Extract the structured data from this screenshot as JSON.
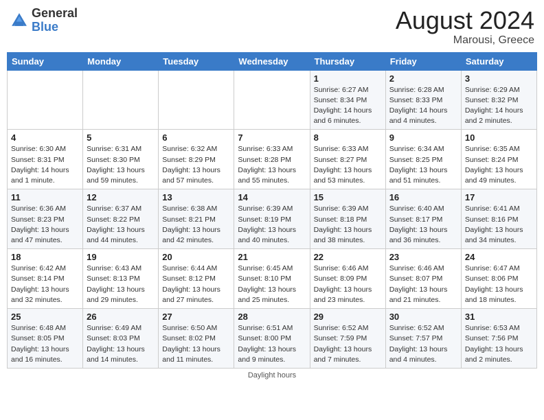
{
  "header": {
    "logo_general": "General",
    "logo_blue": "Blue",
    "month_year": "August 2024",
    "location": "Marousi, Greece"
  },
  "days_of_week": [
    "Sunday",
    "Monday",
    "Tuesday",
    "Wednesday",
    "Thursday",
    "Friday",
    "Saturday"
  ],
  "footer": {
    "note": "Daylight hours"
  },
  "weeks": [
    [
      {
        "day": "",
        "info": ""
      },
      {
        "day": "",
        "info": ""
      },
      {
        "day": "",
        "info": ""
      },
      {
        "day": "",
        "info": ""
      },
      {
        "day": "1",
        "info": "Sunrise: 6:27 AM\nSunset: 8:34 PM\nDaylight: 14 hours\nand 6 minutes."
      },
      {
        "day": "2",
        "info": "Sunrise: 6:28 AM\nSunset: 8:33 PM\nDaylight: 14 hours\nand 4 minutes."
      },
      {
        "day": "3",
        "info": "Sunrise: 6:29 AM\nSunset: 8:32 PM\nDaylight: 14 hours\nand 2 minutes."
      }
    ],
    [
      {
        "day": "4",
        "info": "Sunrise: 6:30 AM\nSunset: 8:31 PM\nDaylight: 14 hours\nand 1 minute."
      },
      {
        "day": "5",
        "info": "Sunrise: 6:31 AM\nSunset: 8:30 PM\nDaylight: 13 hours\nand 59 minutes."
      },
      {
        "day": "6",
        "info": "Sunrise: 6:32 AM\nSunset: 8:29 PM\nDaylight: 13 hours\nand 57 minutes."
      },
      {
        "day": "7",
        "info": "Sunrise: 6:33 AM\nSunset: 8:28 PM\nDaylight: 13 hours\nand 55 minutes."
      },
      {
        "day": "8",
        "info": "Sunrise: 6:33 AM\nSunset: 8:27 PM\nDaylight: 13 hours\nand 53 minutes."
      },
      {
        "day": "9",
        "info": "Sunrise: 6:34 AM\nSunset: 8:25 PM\nDaylight: 13 hours\nand 51 minutes."
      },
      {
        "day": "10",
        "info": "Sunrise: 6:35 AM\nSunset: 8:24 PM\nDaylight: 13 hours\nand 49 minutes."
      }
    ],
    [
      {
        "day": "11",
        "info": "Sunrise: 6:36 AM\nSunset: 8:23 PM\nDaylight: 13 hours\nand 47 minutes."
      },
      {
        "day": "12",
        "info": "Sunrise: 6:37 AM\nSunset: 8:22 PM\nDaylight: 13 hours\nand 44 minutes."
      },
      {
        "day": "13",
        "info": "Sunrise: 6:38 AM\nSunset: 8:21 PM\nDaylight: 13 hours\nand 42 minutes."
      },
      {
        "day": "14",
        "info": "Sunrise: 6:39 AM\nSunset: 8:19 PM\nDaylight: 13 hours\nand 40 minutes."
      },
      {
        "day": "15",
        "info": "Sunrise: 6:39 AM\nSunset: 8:18 PM\nDaylight: 13 hours\nand 38 minutes."
      },
      {
        "day": "16",
        "info": "Sunrise: 6:40 AM\nSunset: 8:17 PM\nDaylight: 13 hours\nand 36 minutes."
      },
      {
        "day": "17",
        "info": "Sunrise: 6:41 AM\nSunset: 8:16 PM\nDaylight: 13 hours\nand 34 minutes."
      }
    ],
    [
      {
        "day": "18",
        "info": "Sunrise: 6:42 AM\nSunset: 8:14 PM\nDaylight: 13 hours\nand 32 minutes."
      },
      {
        "day": "19",
        "info": "Sunrise: 6:43 AM\nSunset: 8:13 PM\nDaylight: 13 hours\nand 29 minutes."
      },
      {
        "day": "20",
        "info": "Sunrise: 6:44 AM\nSunset: 8:12 PM\nDaylight: 13 hours\nand 27 minutes."
      },
      {
        "day": "21",
        "info": "Sunrise: 6:45 AM\nSunset: 8:10 PM\nDaylight: 13 hours\nand 25 minutes."
      },
      {
        "day": "22",
        "info": "Sunrise: 6:46 AM\nSunset: 8:09 PM\nDaylight: 13 hours\nand 23 minutes."
      },
      {
        "day": "23",
        "info": "Sunrise: 6:46 AM\nSunset: 8:07 PM\nDaylight: 13 hours\nand 21 minutes."
      },
      {
        "day": "24",
        "info": "Sunrise: 6:47 AM\nSunset: 8:06 PM\nDaylight: 13 hours\nand 18 minutes."
      }
    ],
    [
      {
        "day": "25",
        "info": "Sunrise: 6:48 AM\nSunset: 8:05 PM\nDaylight: 13 hours\nand 16 minutes."
      },
      {
        "day": "26",
        "info": "Sunrise: 6:49 AM\nSunset: 8:03 PM\nDaylight: 13 hours\nand 14 minutes."
      },
      {
        "day": "27",
        "info": "Sunrise: 6:50 AM\nSunset: 8:02 PM\nDaylight: 13 hours\nand 11 minutes."
      },
      {
        "day": "28",
        "info": "Sunrise: 6:51 AM\nSunset: 8:00 PM\nDaylight: 13 hours\nand 9 minutes."
      },
      {
        "day": "29",
        "info": "Sunrise: 6:52 AM\nSunset: 7:59 PM\nDaylight: 13 hours\nand 7 minutes."
      },
      {
        "day": "30",
        "info": "Sunrise: 6:52 AM\nSunset: 7:57 PM\nDaylight: 13 hours\nand 4 minutes."
      },
      {
        "day": "31",
        "info": "Sunrise: 6:53 AM\nSunset: 7:56 PM\nDaylight: 13 hours\nand 2 minutes."
      }
    ]
  ]
}
